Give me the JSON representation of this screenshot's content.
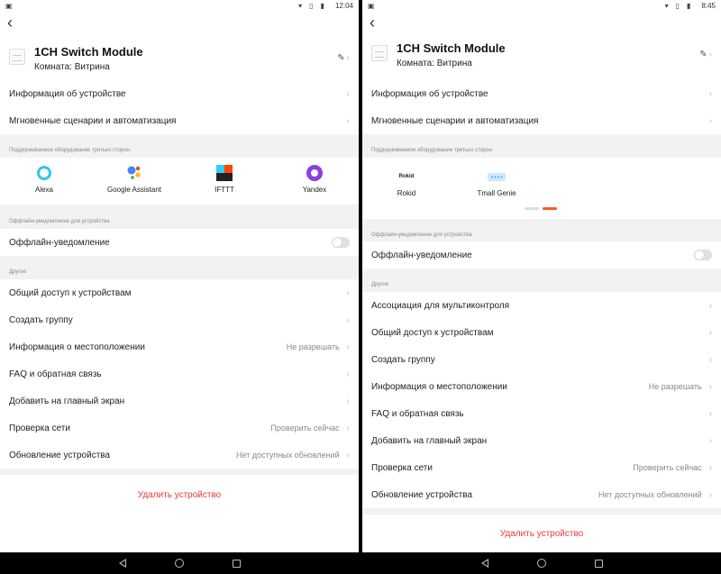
{
  "colors": {
    "accent": "#ff5a1f",
    "delete": "#e63b3b",
    "section_bg": "#f2f2f4"
  },
  "left": {
    "time": "12:04",
    "device": {
      "name": "1CH Switch Module",
      "room": "Комната: Витрина"
    },
    "rows_top": [
      {
        "label": "Информация об устройстве"
      },
      {
        "label": "Мгновенные сценарии и автоматизация"
      }
    ],
    "third_party_title": "Поддерживаемое оборудование третьих сторон",
    "services": [
      {
        "name": "Alexa",
        "icon": "alexa-icon"
      },
      {
        "name": "Google Assistant",
        "icon": "google-assistant-icon"
      },
      {
        "name": "IFTTT",
        "icon": "ifttt-icon"
      },
      {
        "name": "Yandex",
        "icon": "yandex-icon"
      }
    ],
    "offline_title": "Оффлайн-уведомление для устройства",
    "offline_label": "Оффлайн-уведомление",
    "other_title": "Другое",
    "other_rows": [
      {
        "label": "Общий доступ к устройствам",
        "value": ""
      },
      {
        "label": "Создать группу",
        "value": ""
      },
      {
        "label": "Информация о местоположении",
        "value": "Не разрешать"
      },
      {
        "label": "FAQ и обратная связь",
        "value": ""
      },
      {
        "label": "Добавить на главный экран",
        "value": ""
      },
      {
        "label": "Проверка сети",
        "value": "Проверить сейчас"
      },
      {
        "label": "Обновление устройства",
        "value": "Нет доступных обновлений"
      }
    ],
    "delete_label": "Удалить устройство"
  },
  "right": {
    "time": "8:45",
    "device": {
      "name": "1CH Switch Module",
      "room": "Комната: Витрина"
    },
    "rows_top": [
      {
        "label": "Информация об устройстве"
      },
      {
        "label": "Мгновенные сценарии и автоматизация"
      }
    ],
    "third_party_title": "Поддерживаемое оборудование третьих сторон",
    "services": [
      {
        "name": "Rokid",
        "icon": "rokid-icon",
        "logo_text": "Rokid"
      },
      {
        "name": "Tmall Genie",
        "icon": "tmall-genie-icon",
        "logo_text": "Tmall"
      }
    ],
    "offline_title": "Оффлайн-уведомление для устройства",
    "offline_label": "Оффлайн-уведомление",
    "other_title": "Другое",
    "other_rows": [
      {
        "label": "Ассоциация для мультиконтроля",
        "value": ""
      },
      {
        "label": "Общий доступ к устройствам",
        "value": ""
      },
      {
        "label": "Создать группу",
        "value": ""
      },
      {
        "label": "Информация о местоположении",
        "value": "Не разрешать"
      },
      {
        "label": "FAQ и обратная связь",
        "value": ""
      },
      {
        "label": "Добавить на главный экран",
        "value": ""
      },
      {
        "label": "Проверка сети",
        "value": "Проверить сейчас"
      },
      {
        "label": "Обновление устройства",
        "value": "Нет доступных обновлений"
      }
    ],
    "delete_label": "Удалить устройство"
  }
}
